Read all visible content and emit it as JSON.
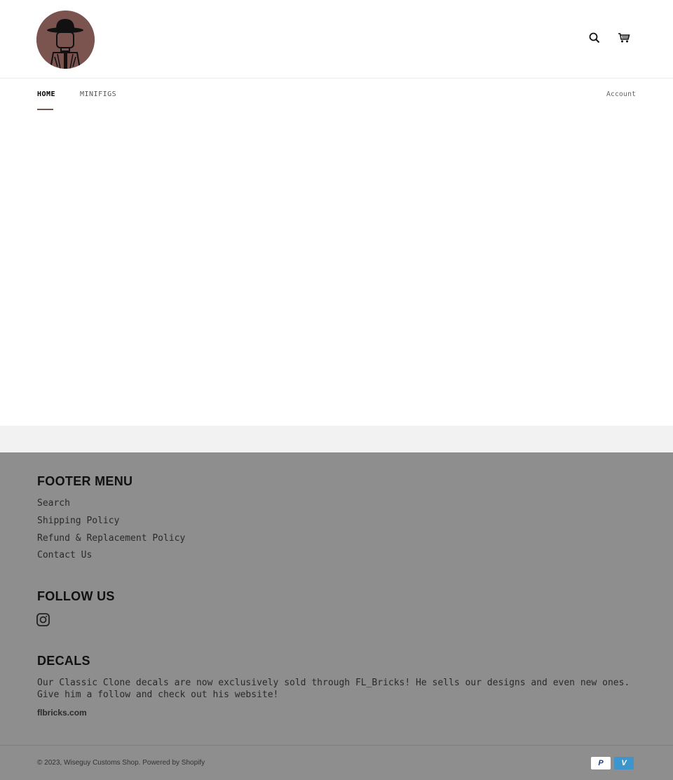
{
  "header": {
    "logo_alt": "Wiseguy Customs Shop logo",
    "icons": {
      "search": "search-icon",
      "cart": "cart-icon"
    }
  },
  "nav": {
    "items": [
      {
        "label": "HOME",
        "active": true
      },
      {
        "label": "MINIFIGS",
        "active": false
      }
    ],
    "account_label": "Account"
  },
  "colors": {
    "accent": "#7b5450",
    "footer_bg": "#8e8e8e",
    "band_bg": "#f2f2f2"
  },
  "footer": {
    "menu_title": "FOOTER MENU",
    "menu_links": [
      "Search",
      "Shipping Policy",
      "Refund & Replacement Policy",
      "Contact Us"
    ],
    "follow_title": "FOLLOW US",
    "social": [
      "instagram-icon"
    ],
    "decals_title": "DECALS",
    "decals_text": "Our Classic Clone decals are now exclusively sold through FL_Bricks! He sells our designs and even new ones.\nGive him a follow and check out his website!",
    "decals_link": "flbricks.com",
    "copyright": "© 2023, Wiseguy Customs Shop. Powered by Shopify",
    "payments": [
      {
        "name": "PayPal",
        "glyph": "P"
      },
      {
        "name": "Venmo",
        "glyph": "V"
      }
    ]
  }
}
